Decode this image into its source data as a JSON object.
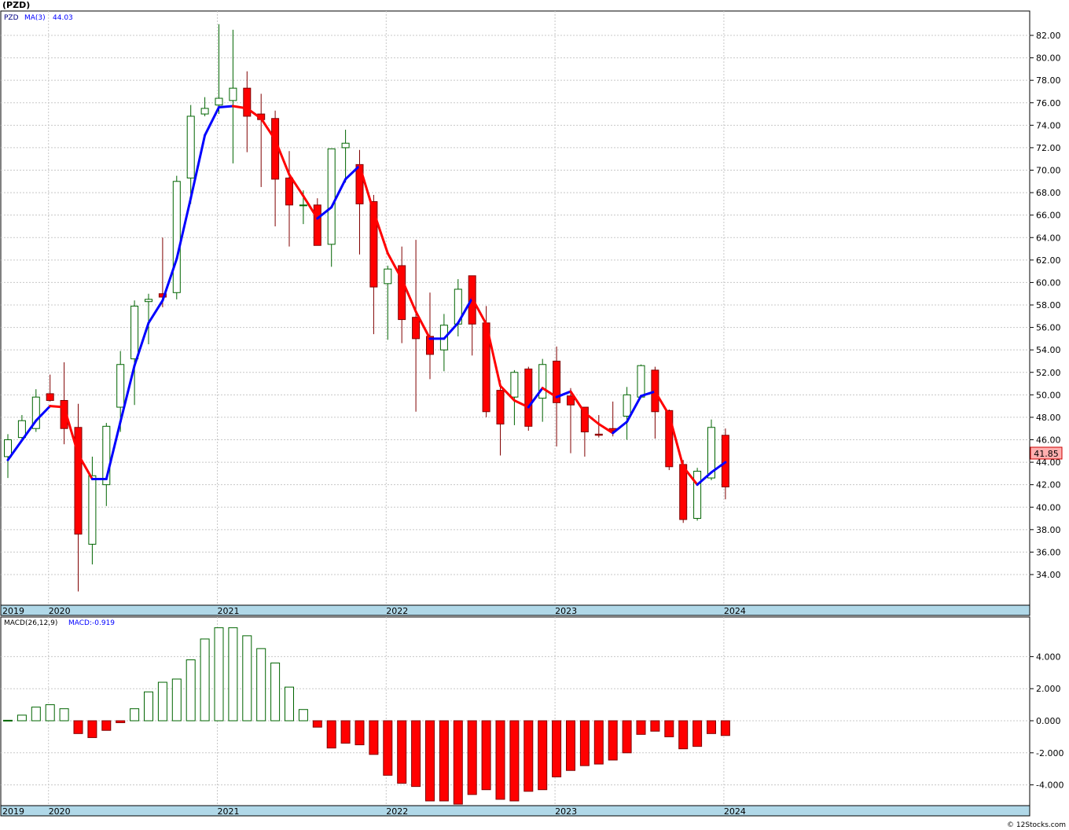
{
  "window": {
    "title": "(PZD)",
    "footer": "© 12Stocks.com"
  },
  "price_panel": {
    "legend_symbol": "PZD",
    "legend_ma_label": "MA(3)",
    "legend_ma_value": "44.03",
    "last_price_label": "41.85",
    "y_ticks": [
      "82.00",
      "80.00",
      "78.00",
      "76.00",
      "74.00",
      "72.00",
      "70.00",
      "68.00",
      "66.00",
      "64.00",
      "62.00",
      "60.00",
      "58.00",
      "56.00",
      "54.00",
      "52.00",
      "50.00",
      "48.00",
      "46.00",
      "44.00",
      "42.00",
      "40.00",
      "38.00",
      "36.00",
      "34.00"
    ],
    "x_labels": [
      "2019",
      "2020",
      "2021",
      "2022",
      "2023",
      "2024"
    ]
  },
  "macd_panel": {
    "legend_label": "MACD(26,12,9)",
    "legend_value": "MACD:-0.919",
    "y_ticks": [
      "4.000",
      "2.000",
      "0.000",
      "-2.000",
      "-4.000"
    ],
    "x_labels": [
      "2019",
      "2020",
      "2021",
      "2022",
      "2023",
      "2024"
    ]
  },
  "colors": {
    "up": "#006400",
    "down": "#ff0000",
    "ma_up": "#0000ff",
    "ma_down": "#ff0000",
    "axis_band": "#b0d8e8",
    "grid": "#c8c8c8"
  },
  "chart_data": [
    {
      "type": "candlestick",
      "title": "(PZD)",
      "ylim": [
        32.5,
        83.5
      ],
      "x": [
        "2019-10",
        "2019-11",
        "2019-12",
        "2020-01",
        "2020-02",
        "2020-03",
        "2020-04",
        "2020-05",
        "2020-06",
        "2020-07",
        "2020-08",
        "2020-09",
        "2020-10",
        "2020-11",
        "2020-12",
        "2021-01",
        "2021-02",
        "2021-03",
        "2021-04",
        "2021-05",
        "2021-06",
        "2021-07",
        "2021-08",
        "2021-09",
        "2021-10",
        "2021-11",
        "2021-12",
        "2022-01",
        "2022-02",
        "2022-03",
        "2022-04",
        "2022-05",
        "2022-06",
        "2022-07",
        "2022-08",
        "2022-09",
        "2022-10",
        "2022-11",
        "2022-12",
        "2023-01",
        "2023-02",
        "2023-03",
        "2023-04",
        "2023-05",
        "2023-06",
        "2023-07",
        "2023-08",
        "2023-09",
        "2023-10",
        "2023-11",
        "2023-12",
        "2024-01"
      ],
      "open": [
        44.5,
        46.2,
        47.0,
        50.1,
        49.5,
        47.1,
        36.7,
        42.0,
        48.9,
        53.2,
        58.3,
        59.0,
        59.1,
        69.3,
        75.0,
        75.8,
        76.2,
        77.3,
        75.0,
        74.6,
        69.3,
        66.9,
        66.9,
        63.4,
        72.0,
        70.5,
        67.2,
        59.9,
        61.5,
        56.9,
        55.2,
        54.0,
        56.3,
        60.6,
        56.4,
        50.4,
        49.8,
        52.3,
        49.7,
        53.0,
        49.9,
        48.9,
        46.5,
        47.0,
        48.1,
        49.8,
        52.2,
        48.6,
        43.8,
        39.0,
        42.6,
        46.4
      ],
      "close": [
        46.0,
        47.7,
        49.8,
        49.5,
        47.0,
        37.6,
        42.8,
        47.2,
        52.7,
        57.9,
        58.5,
        58.7,
        69.0,
        74.8,
        75.5,
        76.4,
        77.3,
        74.8,
        74.5,
        69.2,
        66.9,
        66.9,
        63.3,
        71.9,
        72.4,
        67.0,
        59.6,
        61.2,
        56.7,
        55.0,
        53.6,
        56.2,
        59.4,
        56.3,
        48.5,
        47.4,
        52.0,
        47.2,
        52.7,
        49.3,
        49.1,
        46.7,
        46.4,
        46.8,
        50.0,
        52.6,
        48.5,
        43.6,
        38.9,
        43.2,
        47.1,
        41.8
      ],
      "high": [
        46.5,
        48.2,
        50.5,
        51.8,
        52.9,
        49.2,
        44.5,
        47.5,
        53.9,
        58.4,
        59.0,
        64.0,
        69.5,
        75.8,
        76.5,
        83.0,
        82.5,
        78.8,
        76.8,
        75.3,
        71.7,
        68.2,
        67.5,
        69.5,
        73.6,
        71.8,
        67.8,
        61.5,
        63.2,
        63.8,
        59.1,
        57.2,
        60.3,
        60.6,
        57.9,
        51.3,
        52.2,
        52.5,
        53.2,
        54.3,
        50.6,
        48.6,
        48.2,
        49.4,
        50.7,
        52.7,
        52.5,
        48.7,
        44.2,
        43.5,
        47.8,
        47.0
      ],
      "low": [
        42.6,
        45.9,
        46.7,
        49.4,
        45.6,
        32.5,
        34.9,
        40.1,
        46.7,
        49.1,
        54.5,
        57.8,
        58.5,
        67.0,
        74.8,
        75.0,
        70.6,
        71.6,
        68.5,
        65.0,
        63.2,
        65.2,
        63.8,
        61.4,
        68.9,
        62.5,
        55.4,
        54.9,
        54.6,
        48.5,
        51.4,
        52.1,
        55.2,
        53.5,
        48.0,
        44.6,
        47.3,
        46.8,
        47.6,
        45.4,
        44.8,
        44.5,
        46.2,
        46.3,
        46.0,
        49.7,
        46.1,
        43.3,
        38.6,
        38.8,
        42.4,
        40.7
      ],
      "ma3": [
        44.2,
        null,
        47.7,
        49.0,
        48.9,
        44.7,
        42.5,
        42.5,
        47.6,
        52.6,
        56.4,
        58.4,
        62.1,
        67.5,
        73.1,
        75.6,
        75.7,
        75.5,
        74.6,
        72.7,
        69.6,
        67.7,
        65.7,
        66.7,
        69.2,
        70.4,
        66.3,
        62.6,
        60.3,
        57.4,
        55.0,
        55.0,
        56.4,
        58.6,
        56.3,
        50.8,
        49.5,
        48.9,
        50.6,
        49.8,
        50.3,
        48.4,
        47.4,
        46.6,
        47.6,
        49.9,
        50.3,
        48.2,
        43.6,
        42.0,
        43.1,
        44.0
      ]
    },
    {
      "type": "bar",
      "title": "MACD(26,12,9)",
      "ylim": [
        -5.2,
        6.0
      ],
      "x": [
        "2019-10",
        "2019-11",
        "2019-12",
        "2020-01",
        "2020-02",
        "2020-03",
        "2020-04",
        "2020-05",
        "2020-06",
        "2020-07",
        "2020-08",
        "2020-09",
        "2020-10",
        "2020-11",
        "2020-12",
        "2021-01",
        "2021-02",
        "2021-03",
        "2021-04",
        "2021-05",
        "2021-06",
        "2021-07",
        "2021-08",
        "2021-09",
        "2021-10",
        "2021-11",
        "2021-12",
        "2022-01",
        "2022-02",
        "2022-03",
        "2022-04",
        "2022-05",
        "2022-06",
        "2022-07",
        "2022-08",
        "2022-09",
        "2022-10",
        "2022-11",
        "2022-12",
        "2023-01",
        "2023-02",
        "2023-03",
        "2023-04",
        "2023-05",
        "2023-06",
        "2023-07",
        "2023-08",
        "2023-09",
        "2023-10",
        "2023-11",
        "2023-12",
        "2024-01"
      ],
      "values": [
        0.03,
        0.35,
        0.85,
        1.0,
        0.75,
        -0.8,
        -1.05,
        -0.6,
        -0.12,
        0.75,
        1.8,
        2.4,
        2.6,
        3.8,
        5.1,
        5.8,
        5.8,
        5.3,
        4.5,
        3.6,
        2.1,
        0.7,
        -0.4,
        -1.7,
        -1.4,
        -1.5,
        -2.1,
        -3.4,
        -3.9,
        -4.1,
        -5.0,
        -5.0,
        -5.2,
        -4.6,
        -4.3,
        -4.9,
        -5.0,
        -4.4,
        -4.3,
        -3.5,
        -3.1,
        -2.8,
        -2.7,
        -2.45,
        -2.0,
        -0.85,
        -0.65,
        -1.0,
        -1.75,
        -1.6,
        -0.8,
        -0.92
      ]
    }
  ]
}
